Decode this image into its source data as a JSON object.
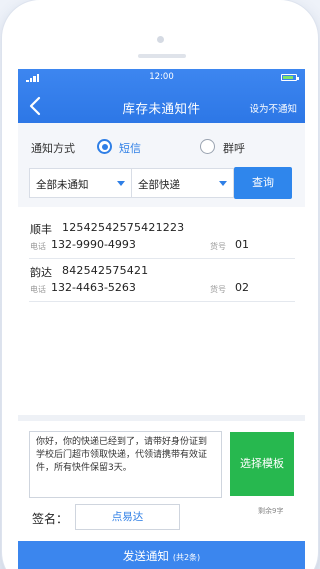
{
  "status_bar": {
    "time": "12:00"
  },
  "nav": {
    "title": "库存未通知件",
    "action": "设为不通知"
  },
  "filter": {
    "notify_label": "通知方式",
    "method_sms": "短信",
    "method_group_call": "群呼",
    "selected_method": "sms",
    "status_select": "全部未通知",
    "courier_select": "全部快递",
    "query_button": "查询"
  },
  "items": [
    {
      "courier": "顺丰",
      "tracking": "12542542575421223",
      "phone_label": "电话",
      "phone": "132-9990-4993",
      "code_label": "货号",
      "code": "01"
    },
    {
      "courier": "韵达",
      "tracking": "842542575421",
      "phone_label": "电话",
      "phone": "132-4463-5263",
      "code_label": "货号",
      "code": "02"
    }
  ],
  "composer": {
    "message": "你好，你的快递已经到了，请带好身份证到学校后门超市领取快递，代领请携带有效证件，所有快件保留3天。",
    "template_button": "选择模板",
    "remaining": "剩余9字",
    "sign_label": "签名：",
    "sign_value": "点易达"
  },
  "send": {
    "label": "发送通知",
    "count": "(共2条)"
  },
  "colors": {
    "accent": "#2f7fe6",
    "header": "#3d86f0",
    "template_green": "#27b84f"
  }
}
